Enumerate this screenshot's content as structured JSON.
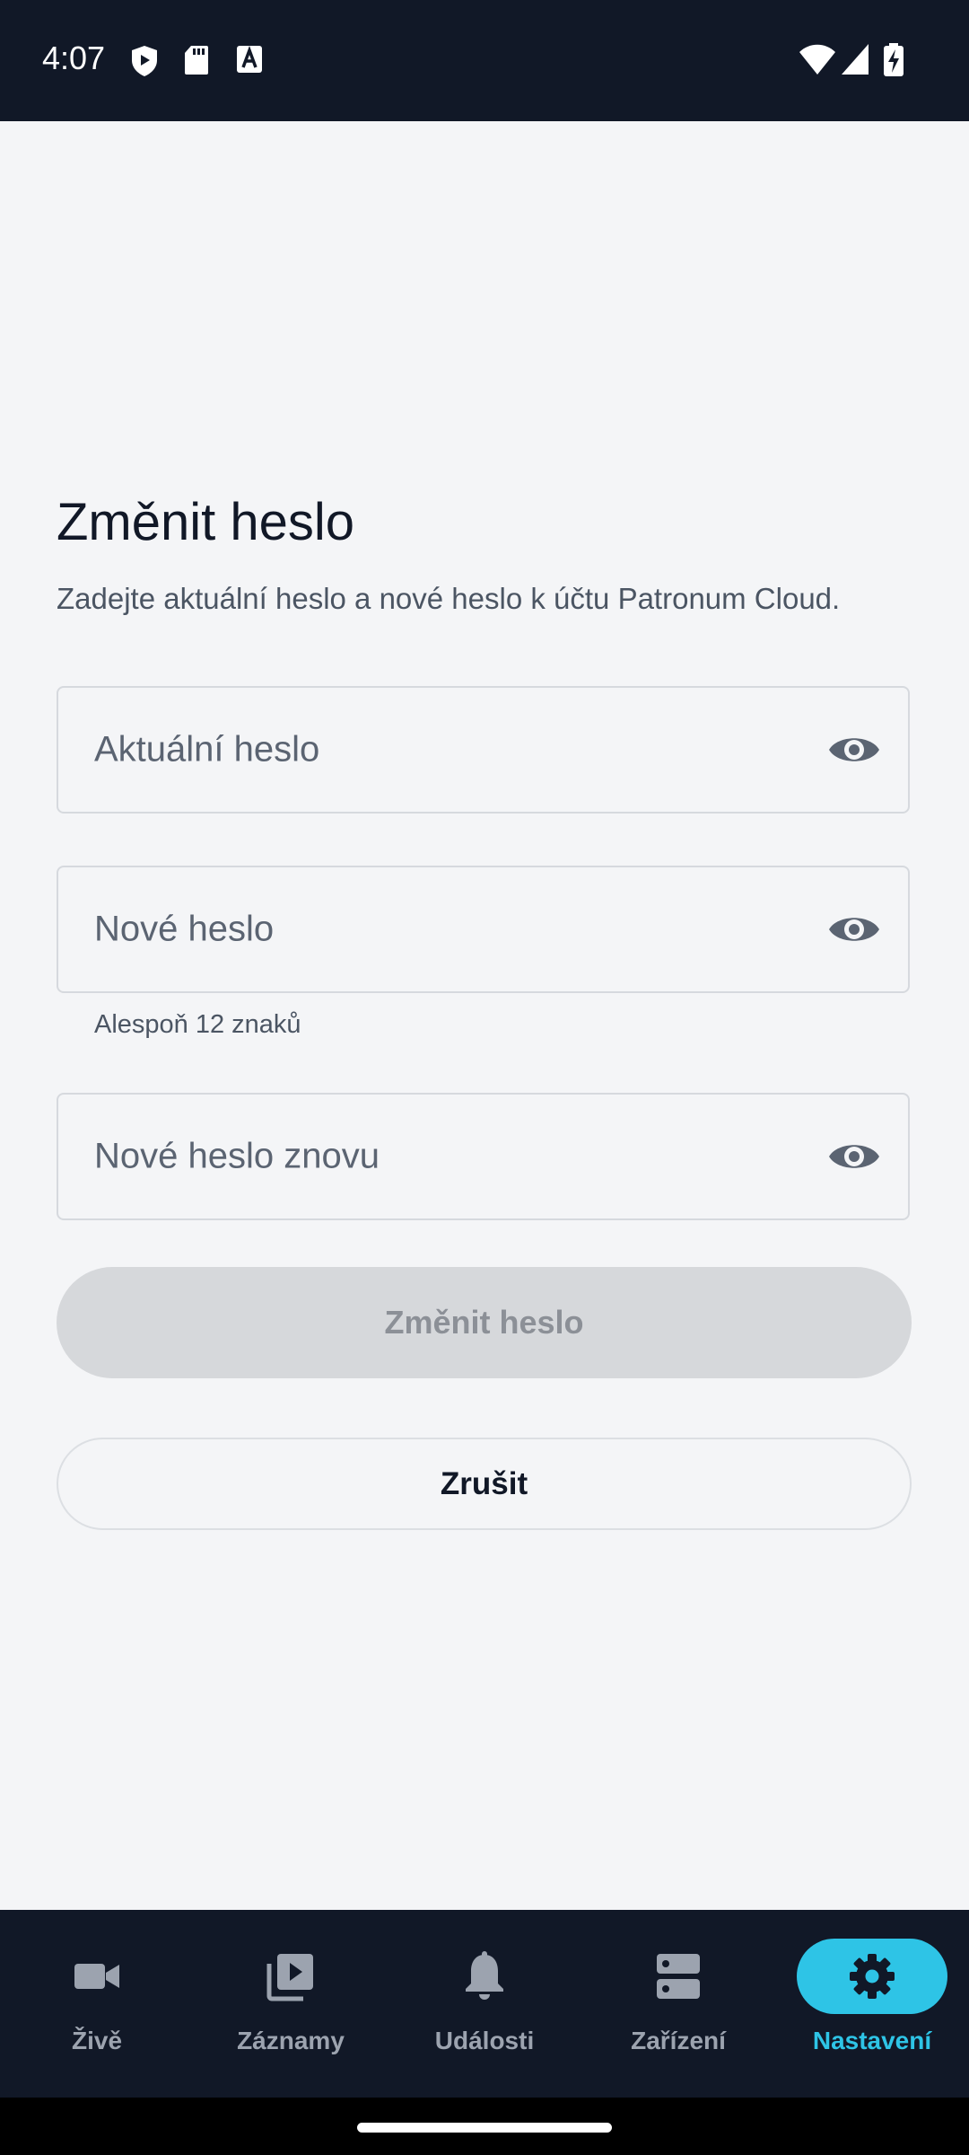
{
  "status": {
    "time": "4:07",
    "icons": [
      "shield-icon",
      "sd-card-icon",
      "font-icon",
      "wifi-icon",
      "signal-icon",
      "battery-charging-icon"
    ]
  },
  "form": {
    "title": "Změnit heslo",
    "subtitle": "Zadejte aktuální heslo a nové heslo k účtu Patronum Cloud.",
    "current_password_placeholder": "Aktuální heslo",
    "new_password_placeholder": "Nové heslo",
    "new_password_helper": "Alespoň 12 znaků",
    "confirm_password_placeholder": "Nové heslo znovu",
    "submit_label": "Změnit heslo",
    "cancel_label": "Zrušit"
  },
  "nav": {
    "items": [
      {
        "label": "Živě",
        "icon": "video-camera-icon"
      },
      {
        "label": "Záznamy",
        "icon": "video-library-icon"
      },
      {
        "label": "Události",
        "icon": "bell-icon"
      },
      {
        "label": "Zařízení",
        "icon": "storage-icon"
      },
      {
        "label": "Nastavení",
        "icon": "gear-icon"
      }
    ],
    "active_index": 4
  },
  "colors": {
    "accent": "#2ec4e6",
    "bar_background": "#111827",
    "page_background": "#f4f5f7",
    "disabled_button": "#d6d8db"
  }
}
